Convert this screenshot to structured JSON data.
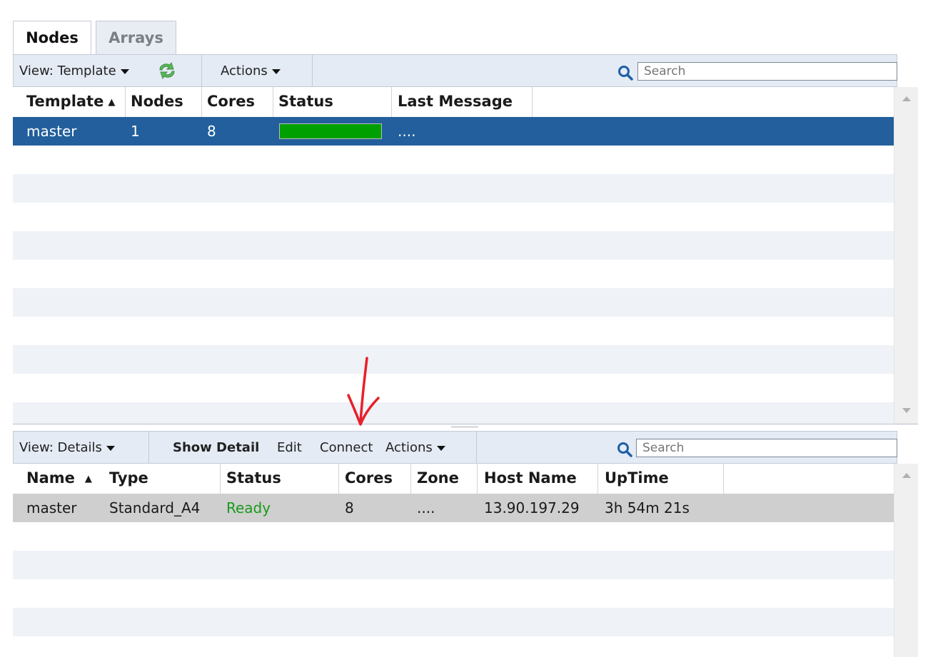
{
  "tabs": [
    {
      "label": "Nodes",
      "active": true
    },
    {
      "label": "Arrays",
      "active": false
    }
  ],
  "top_toolbar": {
    "view_label": "View: Template",
    "refresh_icon": "refresh-icon",
    "actions_label": "Actions",
    "search_placeholder": "Search"
  },
  "top_grid": {
    "columns": [
      "Template",
      "Nodes",
      "Cores",
      "Status",
      "Last Message"
    ],
    "sorted_column": "Template",
    "rows": [
      {
        "template": "master",
        "nodes": "1",
        "cores": "8",
        "status_progress": 1.0,
        "last_message": "...."
      }
    ],
    "status_color": "#00a000",
    "selected_row_color": "#225f9c"
  },
  "bottom_toolbar": {
    "view_label": "View: Details",
    "show_detail_label": "Show Detail",
    "edit_label": "Edit",
    "connect_label": "Connect",
    "actions_label": "Actions",
    "search_placeholder": "Search"
  },
  "bottom_grid": {
    "columns": [
      "Name",
      "Type",
      "Status",
      "Cores",
      "Zone",
      "Host Name",
      "UpTime"
    ],
    "sorted_column": "Name",
    "rows": [
      {
        "name": "master",
        "type": "Standard_A4",
        "status": "Ready",
        "cores": "8",
        "zone": "....",
        "host_name": "13.90.197.29",
        "uptime": "3h 54m 21s"
      }
    ],
    "ready_color": "#1a9a1a"
  },
  "annotation": {
    "arrow_color": "#e8202a"
  }
}
